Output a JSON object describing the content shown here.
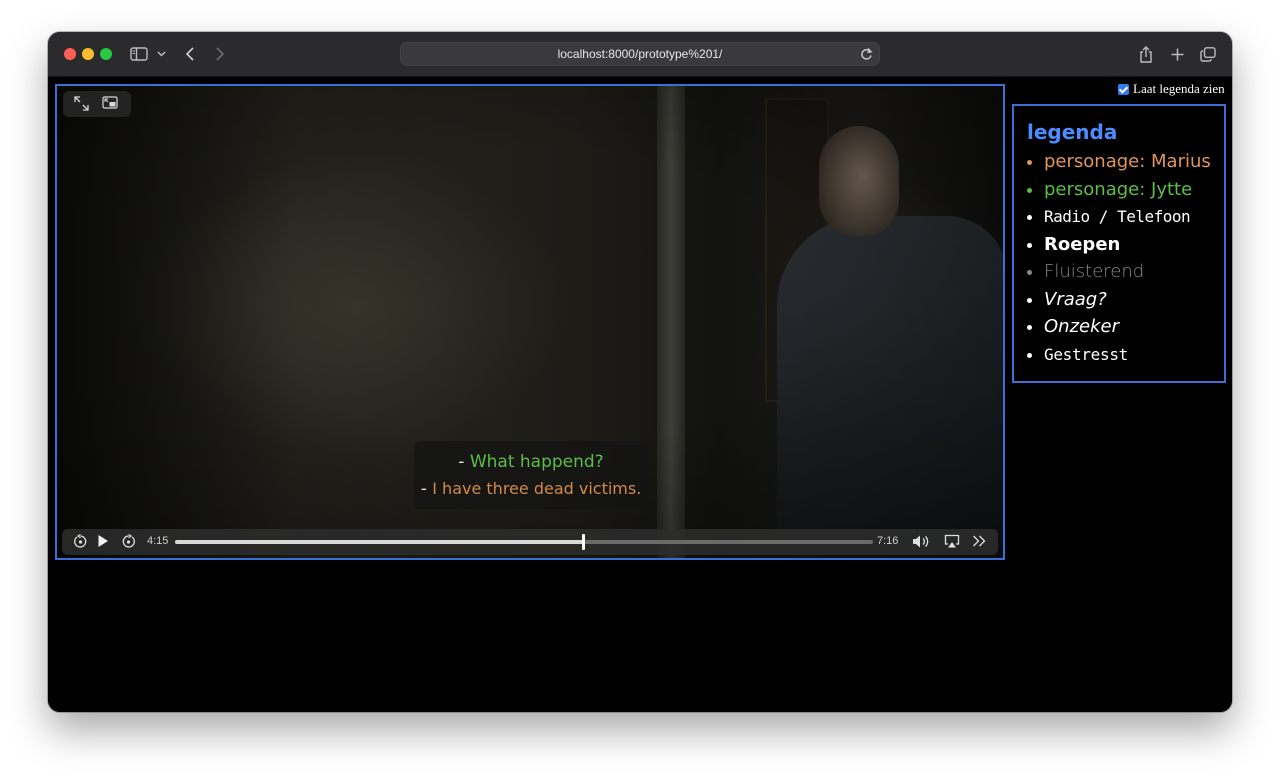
{
  "browser": {
    "url": "localhost:8000/prototype%201/"
  },
  "player": {
    "subtitles": {
      "line1_dash": "-",
      "line1_text": "What happend?",
      "line2_dash": "-",
      "line2_text": "I have three dead victims."
    },
    "current_time": "4:15",
    "total_time": "7:16",
    "progress": 0.585
  },
  "legend_toggle": {
    "label": "Laat legenda zien",
    "checked": true
  },
  "legend": {
    "title": "legenda",
    "items": [
      {
        "label": "personage: Marius",
        "color": "#e0955a",
        "style": "normal"
      },
      {
        "label": "personage: Jytte",
        "color": "#5cbe46",
        "style": "normal"
      },
      {
        "label": "Radio / Telefoon",
        "color": "#ffffff",
        "style": "thin"
      },
      {
        "label": "Roepen",
        "color": "#ffffff",
        "style": "bold"
      },
      {
        "label": "Fluisterend",
        "color": "#8a8a8a",
        "style": "light"
      },
      {
        "label": "Vraag?",
        "color": "#ffffff",
        "style": "italic"
      },
      {
        "label": "Onzeker",
        "color": "#ffffff",
        "style": "italic"
      },
      {
        "label": "Gestresst",
        "color": "#ffffff",
        "style": "shaky"
      }
    ]
  },
  "colors": {
    "accent_border": "#3b6fd4",
    "legend_title": "#4d8cff",
    "subtitle_jytte": "#5cbe46",
    "subtitle_marius": "#d48a48"
  }
}
